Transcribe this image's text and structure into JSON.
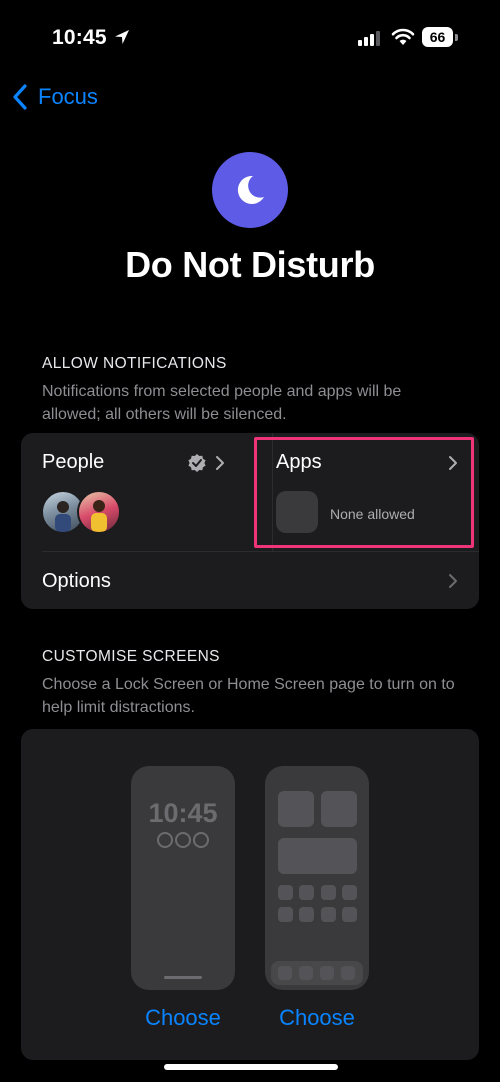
{
  "status_bar": {
    "time": "10:45",
    "battery": "66"
  },
  "nav": {
    "back_label": "Focus"
  },
  "header": {
    "title": "Do Not Disturb",
    "icon": "moon-icon",
    "accent": "#5e5ce6"
  },
  "allow_notifications": {
    "heading": "ALLOW NOTIFICATIONS",
    "description": "Notifications from selected people and apps will be allowed; all others will be silenced.",
    "people_label": "People",
    "apps_label": "Apps",
    "apps_status": "None allowed",
    "options_label": "Options"
  },
  "customise_screens": {
    "heading": "CUSTOMISE SCREENS",
    "description": "Choose a Lock Screen or Home Screen page to turn on to help limit distractions.",
    "lock_preview_time": "10:45",
    "choose_lock": "Choose",
    "choose_home": "Choose"
  },
  "colors": {
    "link": "#0a84ff",
    "highlight": "#f0347a",
    "card": "#1c1c1e"
  }
}
